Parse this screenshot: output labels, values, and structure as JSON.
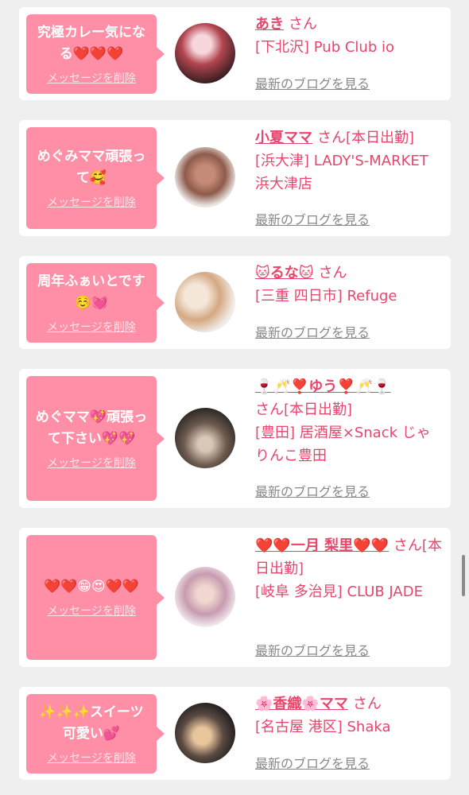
{
  "delete_label": "メッセージを削除",
  "blog_label": "最新のブログを見る",
  "entries": [
    {
      "message": "究極カレー気になる❤️❤️❤️",
      "name": "あき",
      "suffix": "さん",
      "shop": "[下北沢] Pub Club io"
    },
    {
      "message": "めぐみママ頑張って🥰",
      "name": "小夏ママ",
      "suffix": "さん[本日出勤]",
      "shop": "[浜大津] LADY'S-MARKET 浜大津店"
    },
    {
      "message": "周年ふぁいとです☺️💓",
      "name": "🐱るな🐱",
      "suffix": "さん",
      "shop": "[三重 四日市] Refuge"
    },
    {
      "message": "めぐママ💖頑張って下さい💖💖",
      "name": "🍷🥂❣️ゆう❣️🥂🍷",
      "suffix": "さん[本日出勤]",
      "shop": "[豊田] 居酒屋×Snack じゃりんこ豊田"
    },
    {
      "message": "❤️❤️😁😍❤️❤️",
      "name": "❤️❤️一月 梨里❤️❤️",
      "suffix": "さん[本日出勤]",
      "shop": "[岐阜 多治見] CLUB JADE"
    },
    {
      "message": "✨✨✨スイーツ可愛い💕",
      "name": "🌸香織🌸ママ",
      "suffix": "さん",
      "shop": "[名古屋 港区] Shaka"
    }
  ]
}
